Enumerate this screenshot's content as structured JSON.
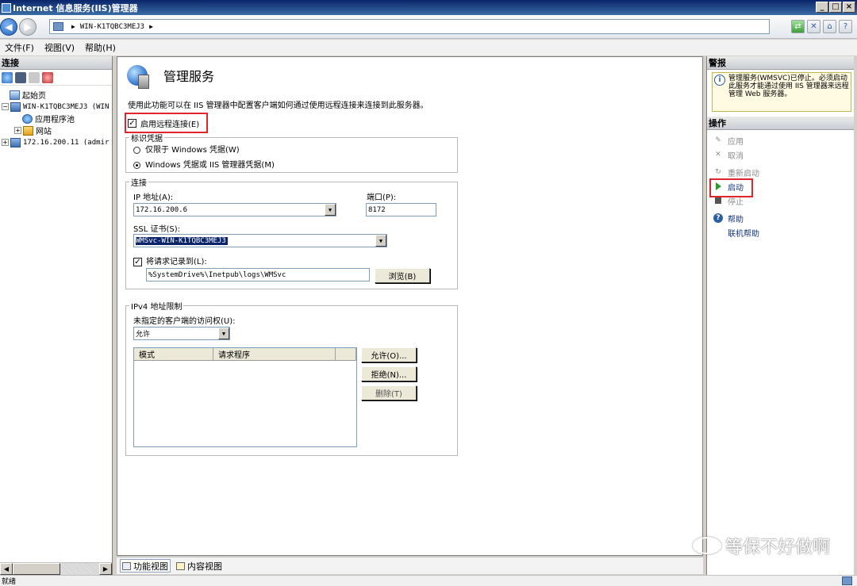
{
  "window": {
    "title": "Internet 信息服务(IIS)管理器"
  },
  "address": {
    "path": "WIN-K1TQBC3MEJ3"
  },
  "menu": {
    "file": "文件(F)",
    "view": "视图(V)",
    "help": "帮助(H)"
  },
  "connections": {
    "header": "连接",
    "tree": {
      "start_page": "起始页",
      "server": "WIN-K1TQBC3MEJ3 (WIN",
      "app_pools": "应用程序池",
      "sites": "网站",
      "remote": "172.16.200.11 (admir"
    }
  },
  "main": {
    "title": "管理服务",
    "description": "使用此功能可以在 IIS 管理器中配置客户端如何通过使用远程连接来连接到此服务器。",
    "enable_remote": {
      "label": "启用远程连接(E)",
      "checked": true
    },
    "identity": {
      "legend": "标识凭据",
      "option_windows": "仅限于 Windows 凭据(W)",
      "option_both": "Windows 凭据或 IIS 管理器凭据(M)",
      "selected": "option_both"
    },
    "connection": {
      "legend": "连接",
      "ip_label": "IP 地址(A):",
      "ip_value": "172.16.200.6",
      "port_label": "端口(P):",
      "port_value": "8172",
      "ssl_label": "SSL 证书(S):",
      "ssl_value": "WMSvc-WIN-K1TQBC3MEJ3",
      "log_label": "将请求记录到(L):",
      "log_checked": true,
      "log_path": "%SystemDrive%\\Inetpub\\logs\\WMSvc",
      "browse": "浏览(B)"
    },
    "ipv4": {
      "legend": "IPv4 地址限制",
      "access_label": "未指定的客户端的访问权(U):",
      "access_value": "允许",
      "col_mode": "模式",
      "col_requester": "请求程序",
      "allow_btn": "允许(O)...",
      "deny_btn": "拒绝(N)...",
      "delete_btn": "删除(T)"
    }
  },
  "views": {
    "features": "功能视图",
    "content": "内容视图"
  },
  "alerts": {
    "header": "警报",
    "message": "管理服务(WMSVC)已停止。必须启动此服务才能通过使用 IIS 管理器来远程管理 Web 服务器。"
  },
  "actions": {
    "header": "操作",
    "apply": "应用",
    "cancel": "取消",
    "restart": "重新启动",
    "start": "启动",
    "stop": "停止",
    "help": "帮助",
    "online_help": "联机帮助"
  },
  "watermark": "等保不好做啊",
  "status": {
    "text": "就绪"
  },
  "colors": {
    "highlight": "#e0262a",
    "title_bar": "#0a246a",
    "link": "#13357e"
  }
}
